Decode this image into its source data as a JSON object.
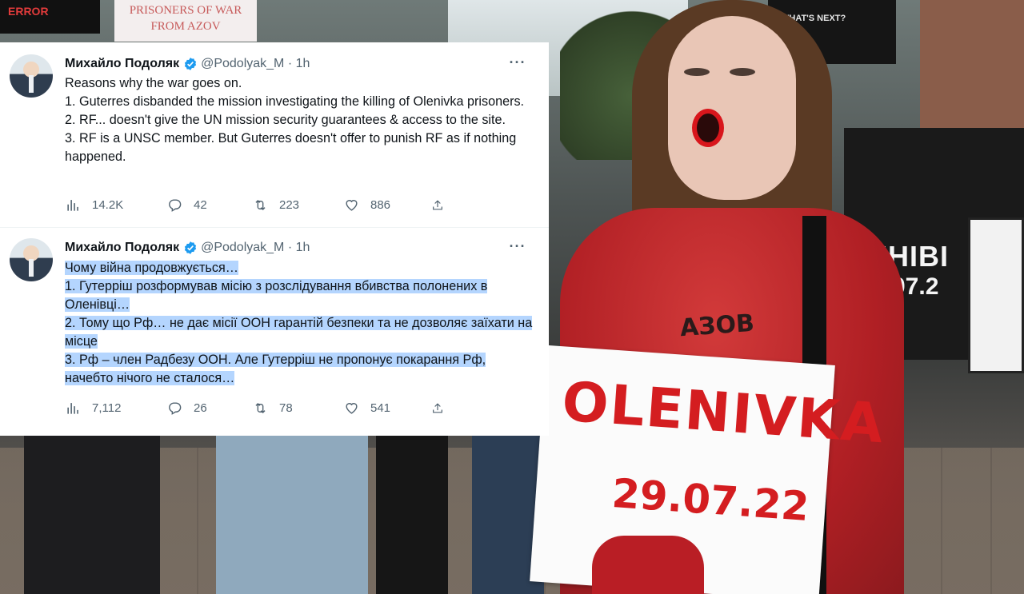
{
  "background": {
    "sign_top_left": "ERROR",
    "sign_top_mid_line1": "PRISONERS OF WAR",
    "sign_top_mid_line2": "FROM AZOV",
    "sign_top_right_line1": "WHAT'S NEXT?",
    "sign_right_line1": "ЕНІВІ",
    "sign_right_line2": "07.2",
    "shirt_text": "АЗОВ",
    "placard_line1": "OLENIVKA",
    "placard_line2": "29.07.22"
  },
  "tweets": [
    {
      "name": "Михайло Подоляк",
      "handle": "@Podolyak_M · 1h",
      "lines": [
        "Reasons why the war goes on.",
        "1. Guterres disbanded the mission investigating the killing of Olenivka prisoners.",
        "2. RF... doesn't give the UN mission security guarantees & access to the site.",
        "3. RF is a UNSC member. But Guterres doesn't offer to punish RF as if nothing happened."
      ],
      "views": "14.2K",
      "replies": "42",
      "retweets": "223",
      "likes": "886"
    },
    {
      "name": "Михайло Подоляк",
      "handle": "@Podolyak_M · 1h",
      "lines": [
        "Чому війна продовжується…",
        "1. Гутерріш розформував місію з розслідування вбивства полонених в Оленівці…",
        "2. Тому що Рф… не дає місії ООН гарантій безпеки та не дозволяє заїхати на місце",
        "3. Рф – член Радбезу ООН. Але Гутерріш не пропонує покарання Рф, начебто нічого не сталося…"
      ],
      "views": "7,112",
      "replies": "26",
      "retweets": "78",
      "likes": "541"
    }
  ],
  "colors": {
    "verified": "#1d9bf0",
    "selection": "#b4d5fe",
    "secondary_text": "#536471"
  }
}
